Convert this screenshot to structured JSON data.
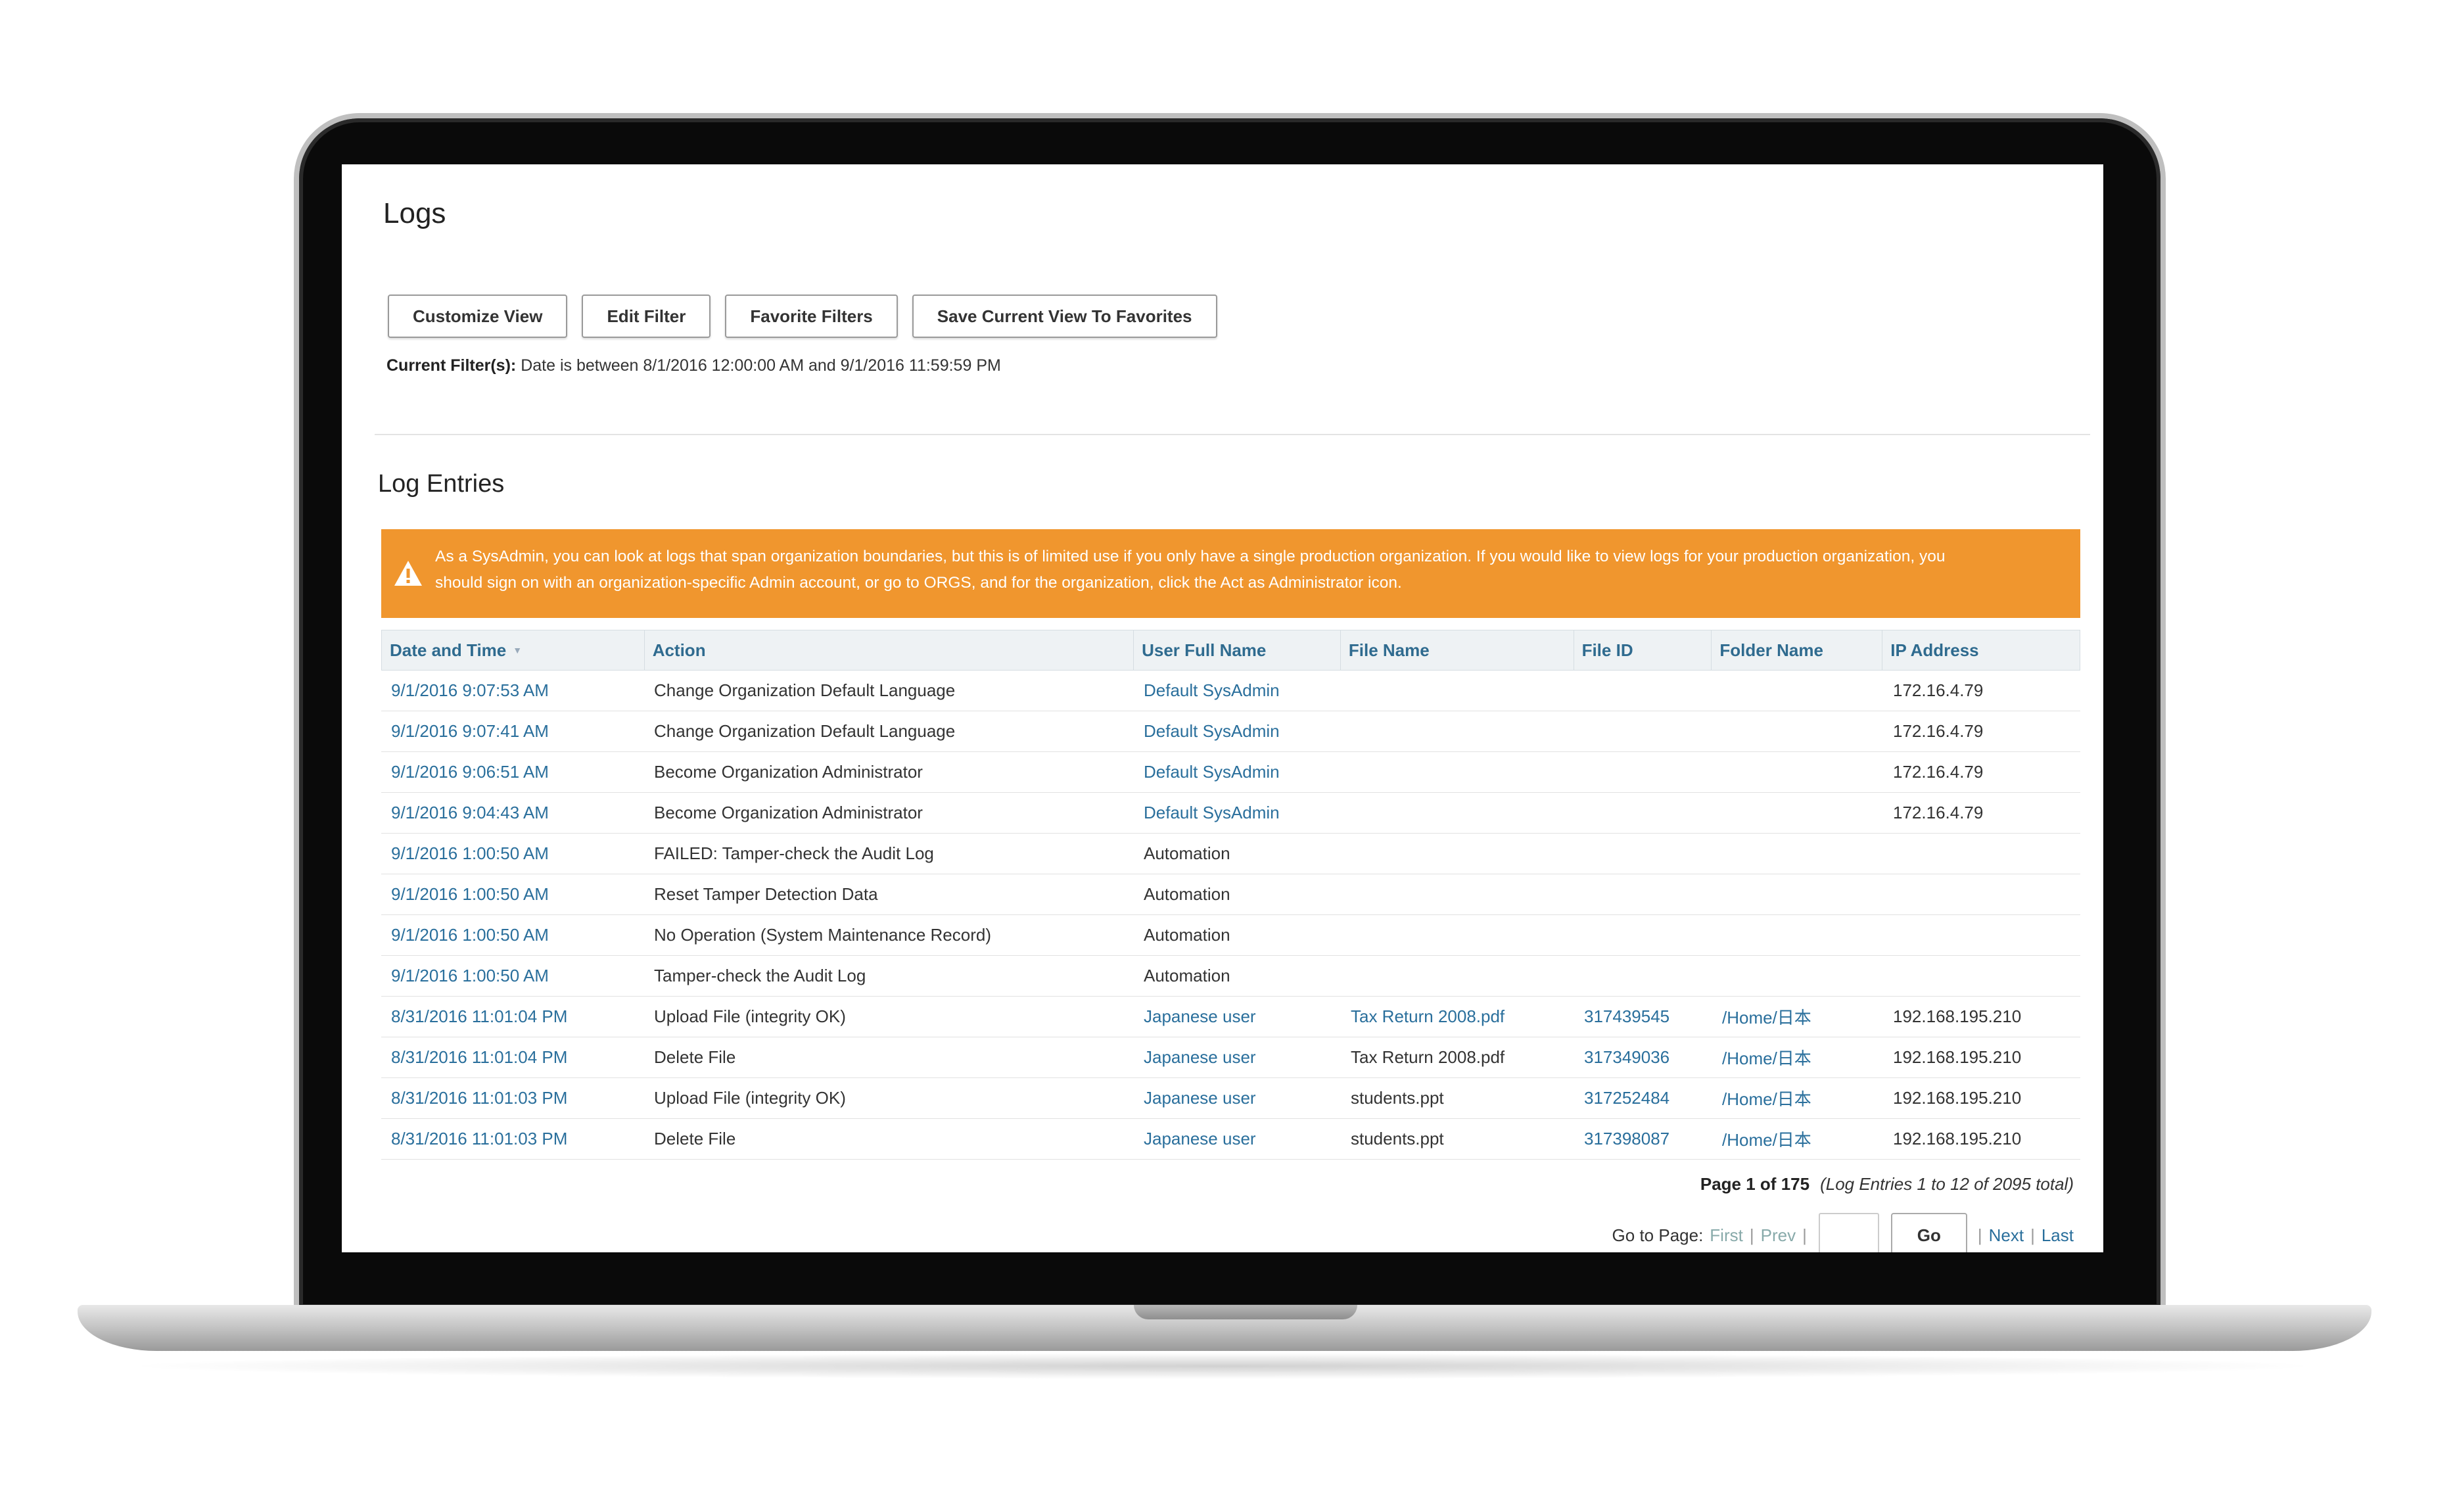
{
  "app": {
    "title": "Logs"
  },
  "toolbar": {
    "customize_view": "Customize View",
    "edit_filter": "Edit Filter",
    "favorite_filters": "Favorite Filters",
    "save_view": "Save Current View To Favorites"
  },
  "filter": {
    "label": "Current Filter(s):",
    "value": "Date is between 8/1/2016 12:00:00 AM and 9/1/2016 11:59:59 PM"
  },
  "log_entries": {
    "title": "Log Entries",
    "alert_line1": "As a SysAdmin, you can look at logs that span organization boundaries, but this is of limited use if you only have a single production organization. If you would like to view logs for your production organization, you",
    "alert_line2": "should sign on with an organization-specific Admin account, or go to ORGS, and for the organization, click the Act as Administrator icon.",
    "alert_icon": "warning-icon",
    "alert_color": "#f0962e"
  },
  "table": {
    "headers": [
      "Date and Time",
      "Action",
      "User Full Name",
      "File Name",
      "File ID",
      "Folder Name",
      "IP Address"
    ],
    "rows": [
      [
        "9/1/2016 9:07:53 AM",
        "Change Organization Default Language",
        "Default SysAdmin",
        "",
        "",
        "",
        "172.16.4.79"
      ],
      [
        "9/1/2016 9:07:41 AM",
        "Change Organization Default Language",
        "Default SysAdmin",
        "",
        "",
        "",
        "172.16.4.79"
      ],
      [
        "9/1/2016 9:06:51 AM",
        "Become Organization Administrator",
        "Default SysAdmin",
        "",
        "",
        "",
        "172.16.4.79"
      ],
      [
        "9/1/2016 9:04:43 AM",
        "Become Organization Administrator",
        "Default SysAdmin",
        "",
        "",
        "",
        "172.16.4.79"
      ],
      [
        "9/1/2016 1:00:50 AM",
        "FAILED: Tamper-check the Audit Log",
        "Automation",
        "",
        "",
        "",
        ""
      ],
      [
        "9/1/2016 1:00:50 AM",
        "Reset Tamper Detection Data",
        "Automation",
        "",
        "",
        "",
        ""
      ],
      [
        "9/1/2016 1:00:50 AM",
        "No Operation (System Maintenance Record)",
        "Automation",
        "",
        "",
        "",
        ""
      ],
      [
        "9/1/2016 1:00:50 AM",
        "Tamper-check the Audit Log",
        "Automation",
        "",
        "",
        "",
        ""
      ],
      [
        "8/31/2016 11:01:04 PM",
        "Upload File (integrity OK)",
        "Japanese user",
        "Tax Return 2008.pdf",
        "317439545",
        "/Home/日本",
        "192.168.195.210"
      ],
      [
        "8/31/2016 11:01:04 PM",
        "Delete File",
        "Japanese user",
        "Tax Return 2008.pdf",
        "317349036",
        "/Home/日本",
        "192.168.195.210"
      ],
      [
        "8/31/2016 11:01:03 PM",
        "Upload File (integrity OK)",
        "Japanese user",
        "students.ppt",
        "317252484",
        "/Home/日本",
        "192.168.195.210"
      ],
      [
        "8/31/2016 11:01:03 PM",
        "Delete File",
        "Japanese user",
        "students.ppt",
        "317398087",
        "/Home/日本",
        "192.168.195.210"
      ]
    ]
  },
  "pagination": {
    "page_info": "Page 1 of 175",
    "entries_info": "(Log Entries 1 to 12 of 2095 total)",
    "go_to_label": "Go to Page:",
    "first": "First",
    "prev": "Prev",
    "go": "Go",
    "next": "Next",
    "last": "Last"
  }
}
